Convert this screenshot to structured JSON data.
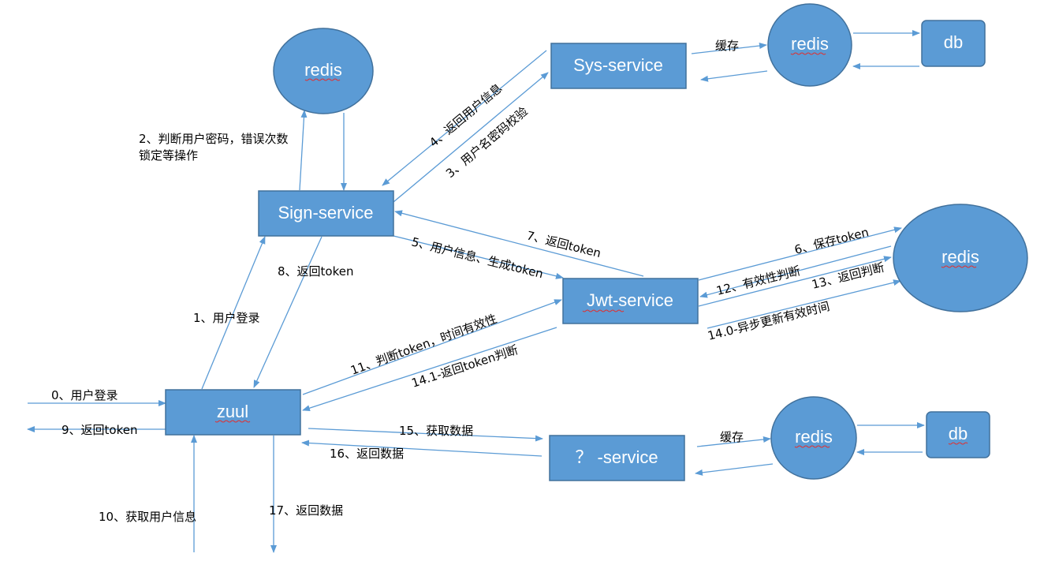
{
  "colors": {
    "node_fill": "#5b9bd5",
    "node_stroke": "#41719c",
    "arrow": "#5b9bd5",
    "spellcheck_underline": "#e03030"
  },
  "nodes": {
    "sign_service": "Sign-service",
    "sys_service": "Sys-service",
    "jwt_service": "Jwt-service",
    "zuul": "zuul",
    "unknown_service": "？ -service",
    "redis_sign": "redis",
    "redis_sys": "redis",
    "redis_jwt": "redis",
    "redis_unknown": "redis",
    "db_sys": "db",
    "db_unknown": "db"
  },
  "notes": {
    "sign_redis_line1": "2、判断用户密码，错误次数",
    "sign_redis_line2": "锁定等操作"
  },
  "edges": {
    "user_login_in": "0、用户登录",
    "return_token_out": "9、返回token",
    "zuul_to_sign": "1、用户登录",
    "sign_to_zuul": "8、返回token",
    "sign_to_sys": "3、用户名密码校验",
    "sys_to_sign": "4、返回用户信息",
    "sign_to_jwt": "5、用户信息、生成token",
    "jwt_to_sign": "7、返回token",
    "jwt_to_redis_save": "6、保存token",
    "redis_to_jwt_valid": "12、有效性判断",
    "jwt_to_redis_return": "13、返回判断",
    "async_update": "14.0-异步更新有效时间",
    "zuul_to_jwt": "11、判断token，时间有效性",
    "jwt_to_zuul": "14.1-返回token判断",
    "zuul_to_unknown": "15、获取数据",
    "unknown_to_zuul": "16、返回数据",
    "get_user_info": "10、获取用户信息",
    "return_data_out": "17、返回数据",
    "sys_cache": "缓存",
    "unknown_cache": "缓存"
  }
}
